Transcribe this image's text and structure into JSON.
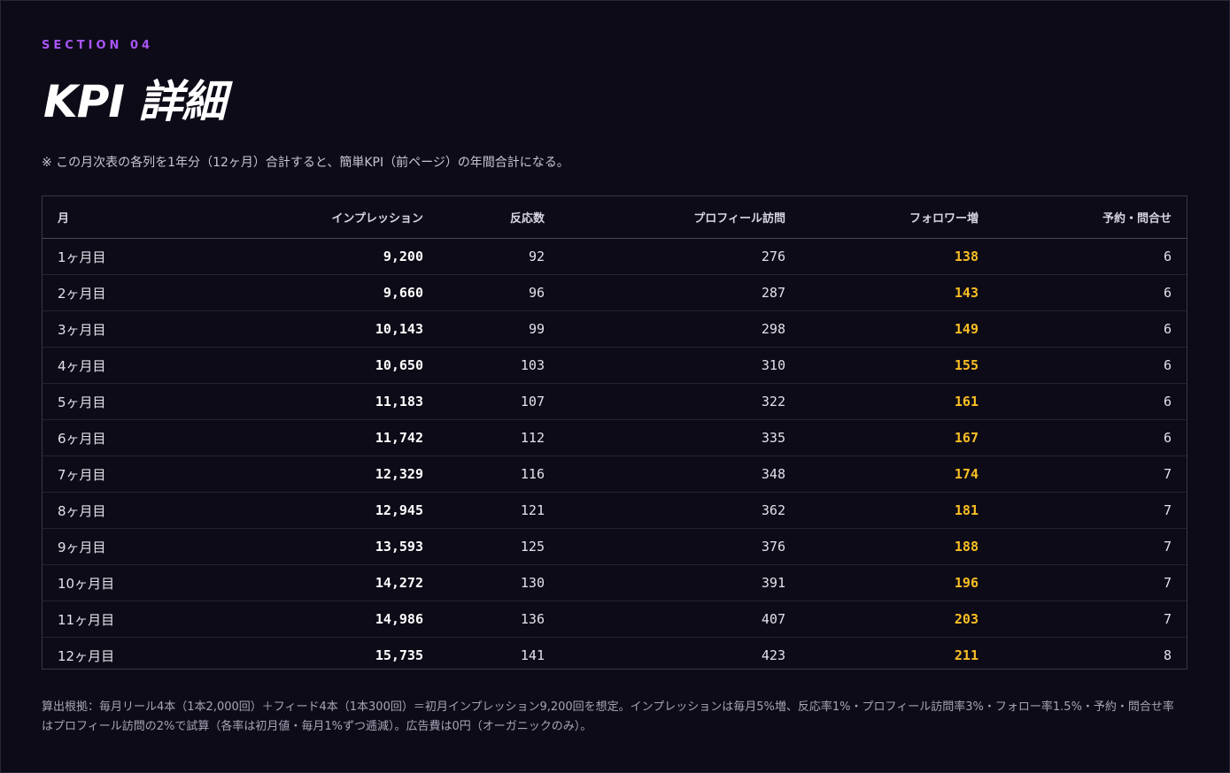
{
  "section_label": "SECTION 04",
  "title": "KPI 詳細",
  "note": "※ この月次表の各列を1年分（12ヶ月）合計すると、簡単KPI（前ページ）の年間合計になる。",
  "table": {
    "headers": {
      "month": "月",
      "impressions": "インプレッション",
      "reactions": "反応数",
      "profile_visits": "プロフィール訪問",
      "follower_gain": "フォロワー増",
      "bookings": "予約・問合せ"
    },
    "rows": [
      {
        "month": "1ヶ月目",
        "impressions": "9,200",
        "reactions": "92",
        "profile_visits": "276",
        "follower_gain": "138",
        "bookings": "6"
      },
      {
        "month": "2ヶ月目",
        "impressions": "9,660",
        "reactions": "96",
        "profile_visits": "287",
        "follower_gain": "143",
        "bookings": "6"
      },
      {
        "month": "3ヶ月目",
        "impressions": "10,143",
        "reactions": "99",
        "profile_visits": "298",
        "follower_gain": "149",
        "bookings": "6"
      },
      {
        "month": "4ヶ月目",
        "impressions": "10,650",
        "reactions": "103",
        "profile_visits": "310",
        "follower_gain": "155",
        "bookings": "6"
      },
      {
        "month": "5ヶ月目",
        "impressions": "11,183",
        "reactions": "107",
        "profile_visits": "322",
        "follower_gain": "161",
        "bookings": "6"
      },
      {
        "month": "6ヶ月目",
        "impressions": "11,742",
        "reactions": "112",
        "profile_visits": "335",
        "follower_gain": "167",
        "bookings": "6"
      },
      {
        "month": "7ヶ月目",
        "impressions": "12,329",
        "reactions": "116",
        "profile_visits": "348",
        "follower_gain": "174",
        "bookings": "7"
      },
      {
        "month": "8ヶ月目",
        "impressions": "12,945",
        "reactions": "121",
        "profile_visits": "362",
        "follower_gain": "181",
        "bookings": "7"
      },
      {
        "month": "9ヶ月目",
        "impressions": "13,593",
        "reactions": "125",
        "profile_visits": "376",
        "follower_gain": "188",
        "bookings": "7"
      },
      {
        "month": "10ヶ月目",
        "impressions": "14,272",
        "reactions": "130",
        "profile_visits": "391",
        "follower_gain": "196",
        "bookings": "7"
      },
      {
        "month": "11ヶ月目",
        "impressions": "14,986",
        "reactions": "136",
        "profile_visits": "407",
        "follower_gain": "203",
        "bookings": "7"
      },
      {
        "month": "12ヶ月目",
        "impressions": "15,735",
        "reactions": "141",
        "profile_visits": "423",
        "follower_gain": "211",
        "bookings": "8"
      }
    ]
  },
  "footer": "算出根拠：毎月リール4本（1本2,000回）＋フィード4本（1本300回）＝初月インプレッション9,200回を想定。インプレッションは毎月5%増、反応率1%・プロフィール訪問率3%・フォロー率1.5%・予約・問合せ率はプロフィール訪問の2%で試算（各率は初月値・毎月1%ずつ逓減）。広告費は0円（オーガニックのみ）。",
  "colors": {
    "background": "#0e0b18",
    "accent": "#a855f7",
    "follower_highlight": "#fbbf24"
  }
}
